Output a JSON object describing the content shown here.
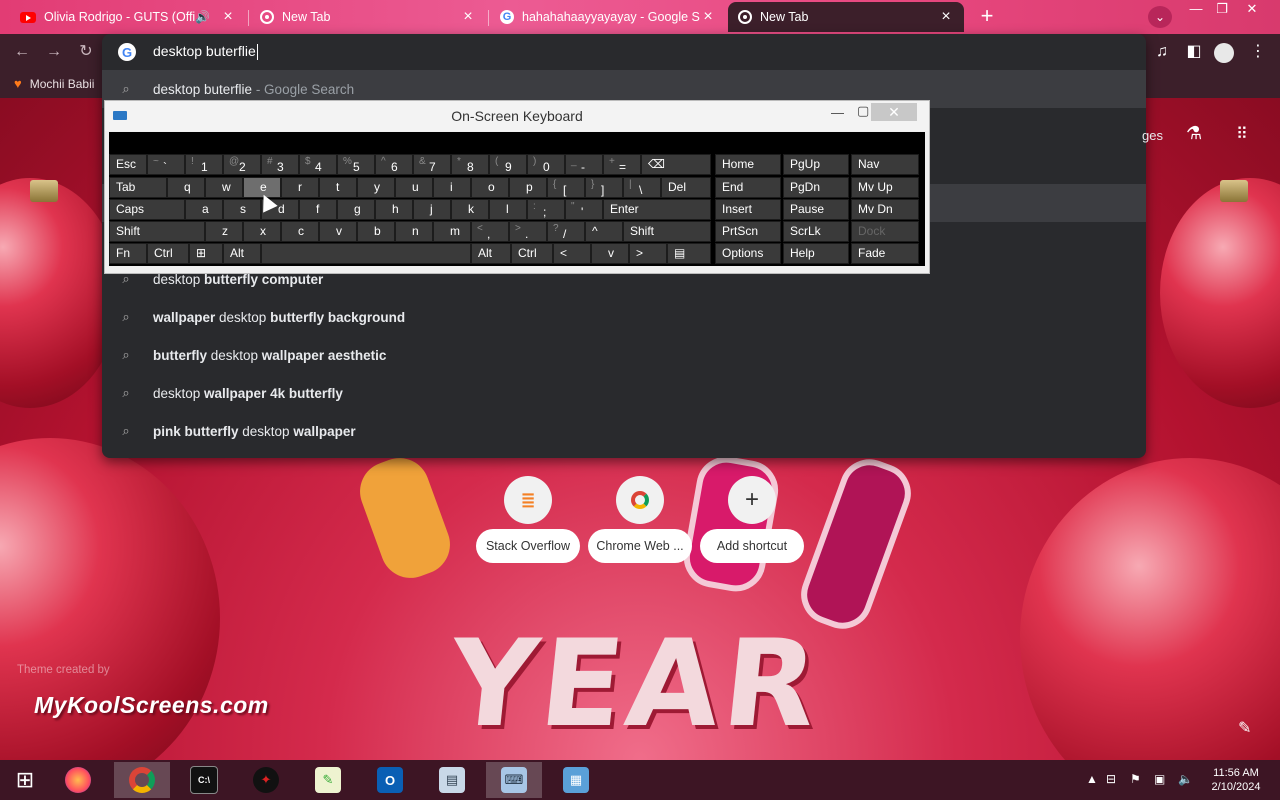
{
  "tabs": [
    {
      "title": "Olivia Rodrigo - GUTS (Offic",
      "icon": "youtube-icon",
      "audio": true
    },
    {
      "title": "New Tab",
      "icon": "chrome-icon"
    },
    {
      "title": "hahahahaayyayayay - Google Se",
      "icon": "google-icon"
    },
    {
      "title": "New Tab",
      "icon": "chrome-icon",
      "active": true
    }
  ],
  "bookmarks": [
    {
      "label": "Mochii Babii"
    }
  ],
  "omnibox": {
    "input": "desktop buterflie",
    "suggestions": [
      {
        "parts": [
          {
            "t": "desktop buterflie",
            "b": false
          }
        ],
        "extra": " - Google Search"
      },
      {
        "parts": [
          {
            "t": "",
            "b": false
          }
        ]
      },
      {
        "parts": [
          {
            "t": "",
            "b": false
          }
        ]
      },
      {
        "parts": [
          {
            "t": "",
            "b": false
          }
        ]
      },
      {
        "parts": [
          {
            "t": "",
            "b": false
          }
        ]
      },
      {
        "parts": [
          {
            "t": "desktop ",
            "b": false
          },
          {
            "t": "butterfly computer",
            "b": true
          }
        ]
      },
      {
        "parts": [
          {
            "t": "wallpaper",
            "b": true
          },
          {
            "t": " desktop ",
            "b": false
          },
          {
            "t": "butterfly background",
            "b": true
          }
        ]
      },
      {
        "parts": [
          {
            "t": "butterfly",
            "b": true
          },
          {
            "t": " desktop ",
            "b": false
          },
          {
            "t": "wallpaper aesthetic",
            "b": true
          }
        ]
      },
      {
        "parts": [
          {
            "t": "desktop ",
            "b": false
          },
          {
            "t": "wallpaper 4k butterfly",
            "b": true
          }
        ]
      },
      {
        "parts": [
          {
            "t": "pink butterfly",
            "b": true
          },
          {
            "t": " desktop ",
            "b": false
          },
          {
            "t": "wallpaper",
            "b": true
          }
        ]
      }
    ],
    "peek_text": "ges"
  },
  "osk": {
    "title": "On-Screen Keyboard",
    "rows": [
      [
        {
          "k": "Esc"
        },
        {
          "s": "~",
          "m": "`"
        },
        {
          "s": "!",
          "m": "1"
        },
        {
          "s": "@",
          "m": "2"
        },
        {
          "s": "#",
          "m": "3"
        },
        {
          "s": "$",
          "m": "4"
        },
        {
          "s": "%",
          "m": "5"
        },
        {
          "s": "^",
          "m": "6"
        },
        {
          "s": "&",
          "m": "7"
        },
        {
          "s": "*",
          "m": "8"
        },
        {
          "s": "(",
          "m": "9"
        },
        {
          "s": ")",
          "m": "0"
        },
        {
          "s": "_",
          "m": "-"
        },
        {
          "s": "+",
          "m": "="
        },
        {
          "k": "⌫"
        }
      ],
      [
        {
          "k": "Tab"
        },
        {
          "k": "q"
        },
        {
          "k": "w"
        },
        {
          "k": "e"
        },
        {
          "k": "r"
        },
        {
          "k": "t"
        },
        {
          "k": "y"
        },
        {
          "k": "u"
        },
        {
          "k": "i"
        },
        {
          "k": "o"
        },
        {
          "k": "p"
        },
        {
          "s": "{",
          "m": "["
        },
        {
          "s": "}",
          "m": "]"
        },
        {
          "s": "|",
          "m": "\\"
        },
        {
          "k": "Del"
        }
      ],
      [
        {
          "k": "Caps"
        },
        {
          "k": "a"
        },
        {
          "k": "s"
        },
        {
          "k": "d"
        },
        {
          "k": "f"
        },
        {
          "k": "g"
        },
        {
          "k": "h"
        },
        {
          "k": "j"
        },
        {
          "k": "k"
        },
        {
          "k": "l"
        },
        {
          "s": ":",
          "m": ";"
        },
        {
          "s": "\"",
          "m": "'"
        },
        {
          "k": "Enter"
        }
      ],
      [
        {
          "k": "Shift"
        },
        {
          "k": "z"
        },
        {
          "k": "x"
        },
        {
          "k": "c"
        },
        {
          "k": "v"
        },
        {
          "k": "b"
        },
        {
          "k": "n"
        },
        {
          "k": "m"
        },
        {
          "s": "<",
          "m": ","
        },
        {
          "s": ">",
          "m": "."
        },
        {
          "s": "?",
          "m": "/"
        },
        {
          "k": "^"
        },
        {
          "k": "Shift"
        }
      ],
      [
        {
          "k": "Fn"
        },
        {
          "k": "Ctrl"
        },
        {
          "k": "⊞"
        },
        {
          "k": "Alt"
        },
        {
          "k": ""
        },
        {
          "k": "Alt"
        },
        {
          "k": "Ctrl"
        },
        {
          "k": "<"
        },
        {
          "k": "v"
        },
        {
          "k": ">"
        },
        {
          "k": "▤"
        }
      ]
    ],
    "nav": [
      [
        "Home",
        "PgUp",
        "Nav"
      ],
      [
        "End",
        "PgDn",
        "Mv Up"
      ],
      [
        "Insert",
        "Pause",
        "Mv Dn"
      ],
      [
        "PrtScn",
        "ScrLk",
        "Dock"
      ],
      [
        "Options",
        "Help",
        "Fade"
      ]
    ]
  },
  "shortcuts": [
    {
      "label": "Stack Overflow",
      "icon": "stackoverflow-icon"
    },
    {
      "label": "Chrome Web ...",
      "icon": "chrome-webstore-icon"
    },
    {
      "label": "Add shortcut",
      "icon": "plus-icon"
    }
  ],
  "theme": {
    "credit": "Theme created by",
    "logo": "MyKoolScreens.com"
  },
  "clock": {
    "time": "11:56 AM",
    "date": "2/10/2024"
  },
  "colors": {
    "tabstrip": "#e23c74",
    "toolbar": "#3c1f2a",
    "omnibox": "#292a2d",
    "taskbar": "#3d1524"
  }
}
